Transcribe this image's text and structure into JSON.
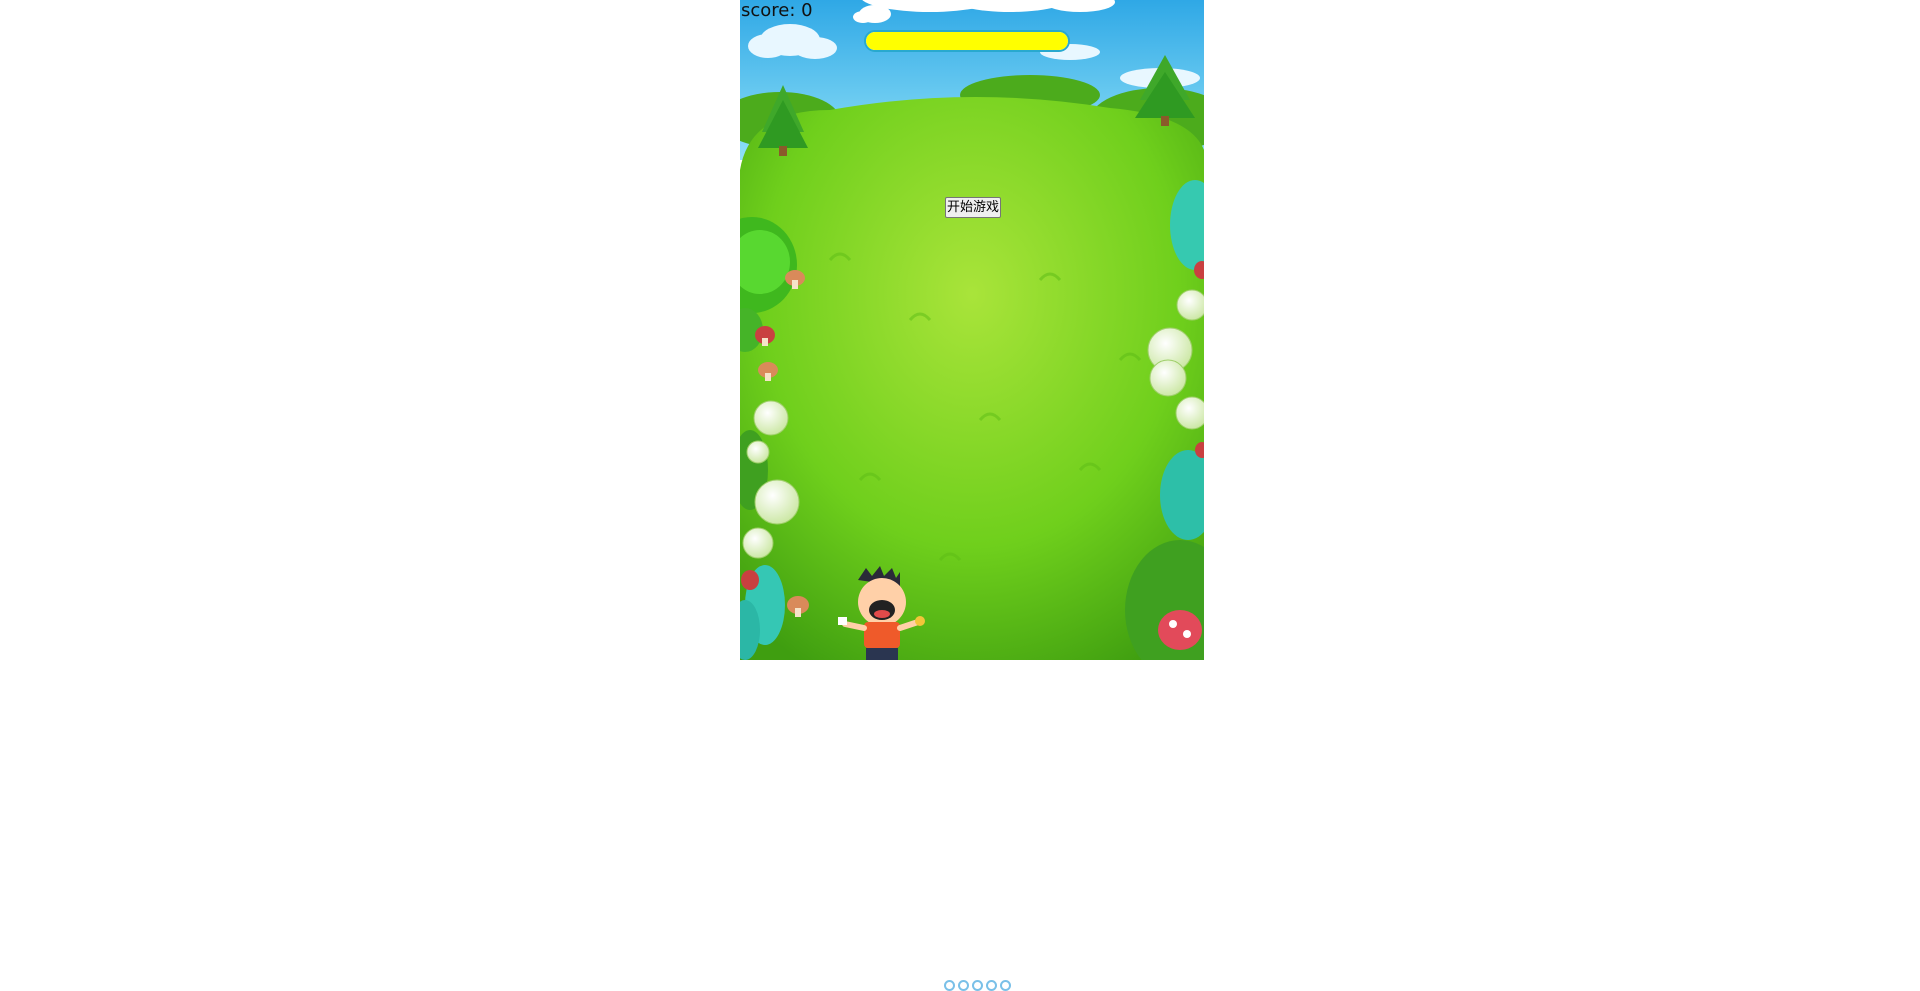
{
  "hud": {
    "score_label": "score:",
    "score_value": "0",
    "timer_fraction": 1.0,
    "timer_color": "#ffff00",
    "timer_border_color": "#28a9cf"
  },
  "start_button": {
    "label": "开始游戏"
  },
  "scene": {
    "background": "grass-field",
    "sky_color": "#4fbfee",
    "grass_color": "#6fcf1c",
    "player": "boy-catcher",
    "player_shirt_color": "#ef5a2a"
  },
  "icons": [
    "cloud-icon",
    "pine-tree-icon",
    "mushroom-icon",
    "egg-stone-icon",
    "coral-plant-icon"
  ]
}
